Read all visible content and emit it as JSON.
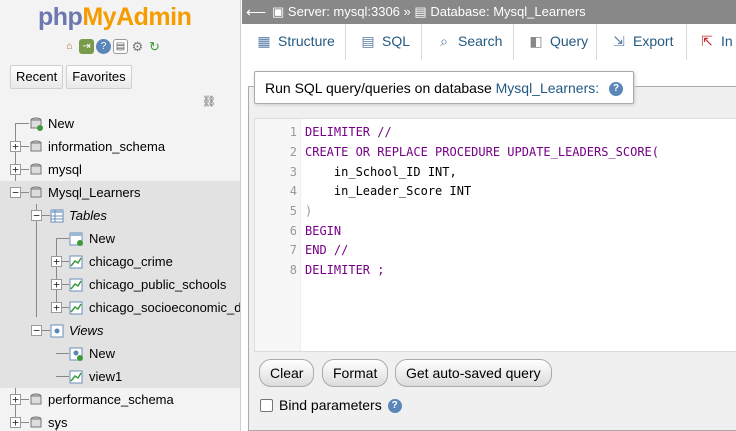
{
  "nav": {
    "logo": {
      "php": "php",
      "my": "My",
      "admin": "Admin"
    },
    "icons": [
      "home-icon",
      "exit-icon",
      "help-icon",
      "docs-icon",
      "settings-icon",
      "reload-icon"
    ],
    "tabs": [
      "Recent",
      "Favorites"
    ],
    "tree": {
      "new": "New",
      "information_schema": "information_schema",
      "mysql": "mysql",
      "mysql_learners": "Mysql_Learners",
      "tables": "Tables",
      "tables_new": "New",
      "tables_items": [
        "chicago_crime",
        "chicago_public_schools",
        "chicago_socioeconomic_d"
      ],
      "views": "Views",
      "views_new": "New",
      "views_items": [
        "view1"
      ],
      "performance_schema": "performance_schema",
      "sys": "sys"
    }
  },
  "topbar": {
    "server": "Server: mysql:3306",
    "separator": "»",
    "database": "Database: Mysql_Learners"
  },
  "tabs": [
    {
      "label": "Structure",
      "icon": "structure-icon"
    },
    {
      "label": "SQL",
      "icon": "sql-icon",
      "active": true
    },
    {
      "label": "Search",
      "icon": "search-icon"
    },
    {
      "label": "Query",
      "icon": "query-icon"
    },
    {
      "label": "Export",
      "icon": "export-icon"
    },
    {
      "label": "In",
      "icon": "import-icon"
    }
  ],
  "sql_panel": {
    "legend_prefix": "Run SQL query/queries on database",
    "legend_db": "Mysql_Learners:",
    "line_numbers": [
      "1",
      "2",
      "3",
      "4",
      "5",
      "6",
      "7",
      "8"
    ],
    "code_lines": [
      "DELIMITER //",
      "CREATE OR REPLACE PROCEDURE UPDATE_LEADERS_SCORE(",
      "    in_School_ID INT,",
      "    in_Leader_Score INT",
      ")",
      "BEGIN",
      "END //",
      "DELIMITER ;"
    ],
    "buttons": {
      "clear": "Clear",
      "format": "Format",
      "autosaved": "Get auto-saved query"
    },
    "bind_parameters": "Bind parameters"
  },
  "colors": {
    "link": "#235a81",
    "keyword": "#770088",
    "topbar": "#888888",
    "logo_blue": "#6c78af",
    "logo_orange": "#f59c00"
  }
}
